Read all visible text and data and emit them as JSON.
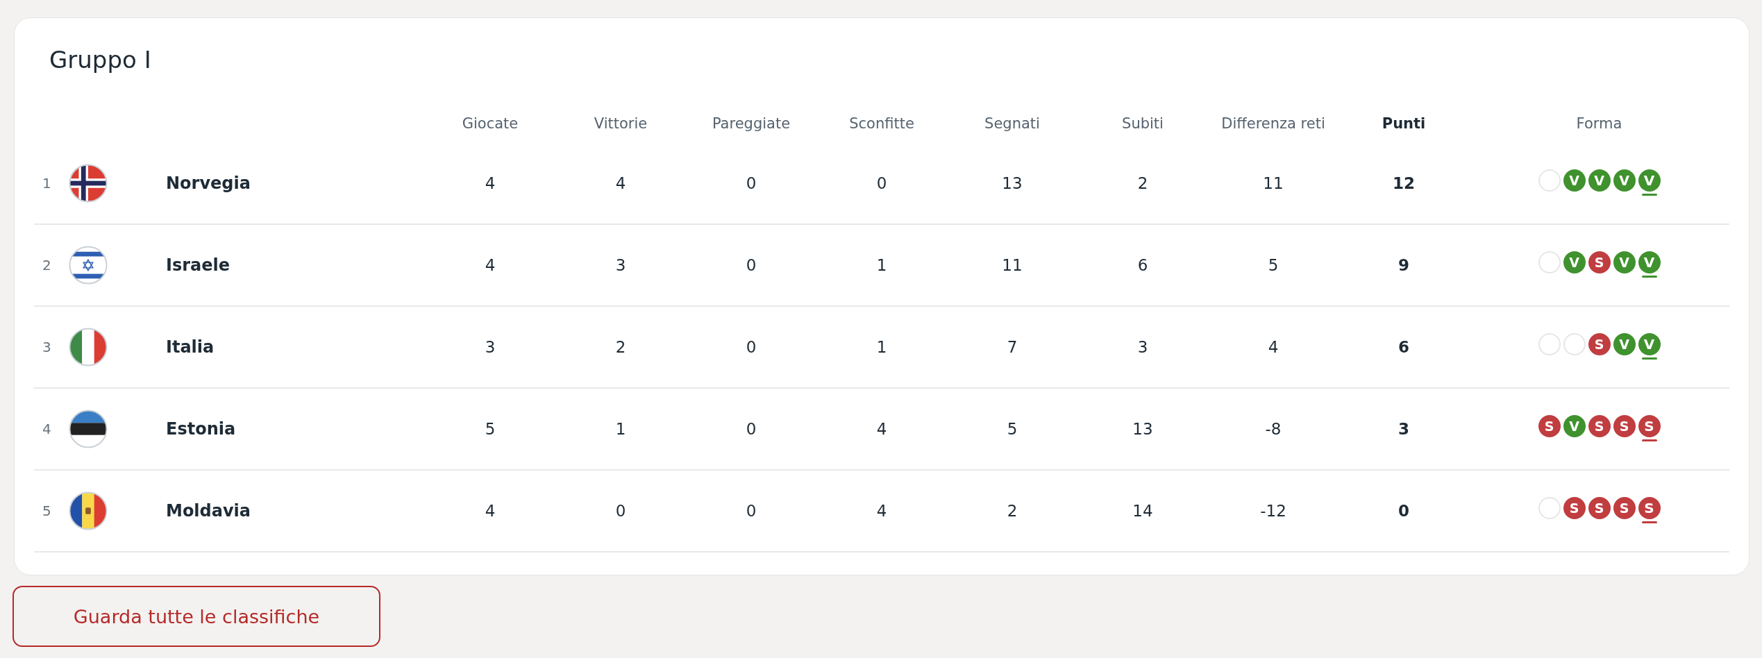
{
  "group": {
    "title": "Gruppo I"
  },
  "columns": [
    {
      "label": "Giocate",
      "bold": false
    },
    {
      "label": "Vittorie",
      "bold": false
    },
    {
      "label": "Pareggiate",
      "bold": false
    },
    {
      "label": "Sconfitte",
      "bold": false
    },
    {
      "label": "Segnati",
      "bold": false
    },
    {
      "label": "Subiti",
      "bold": false
    },
    {
      "label": "Differenza reti",
      "bold": false
    },
    {
      "label": "Punti",
      "bold": true
    },
    {
      "label": "Forma",
      "bold": false
    }
  ],
  "rows": [
    {
      "rank": "1",
      "kind": "norway",
      "team": "Norvegia",
      "stats": [
        "4",
        "4",
        "0",
        "0",
        "13",
        "2",
        "11",
        "12"
      ],
      "form": [
        {
          "kind": "none",
          "latest": false
        },
        {
          "kind": "win",
          "label": "V",
          "latest": false
        },
        {
          "kind": "win",
          "label": "V",
          "latest": false
        },
        {
          "kind": "win",
          "label": "V",
          "latest": false
        },
        {
          "kind": "win",
          "label": "V",
          "latest": true
        }
      ]
    },
    {
      "rank": "2",
      "kind": "israel",
      "team": "Israele",
      "stats": [
        "4",
        "3",
        "0",
        "1",
        "11",
        "6",
        "5",
        "9"
      ],
      "form": [
        {
          "kind": "none",
          "latest": false
        },
        {
          "kind": "win",
          "label": "V",
          "latest": false
        },
        {
          "kind": "loss",
          "label": "S",
          "latest": false
        },
        {
          "kind": "win",
          "label": "V",
          "latest": false
        },
        {
          "kind": "win",
          "label": "V",
          "latest": true
        }
      ]
    },
    {
      "rank": "3",
      "kind": "italy",
      "team": "Italia",
      "stats": [
        "3",
        "2",
        "0",
        "1",
        "7",
        "3",
        "4",
        "6"
      ],
      "form": [
        {
          "kind": "none",
          "latest": false
        },
        {
          "kind": "none",
          "latest": false
        },
        {
          "kind": "loss",
          "label": "S",
          "latest": false
        },
        {
          "kind": "win",
          "label": "V",
          "latest": false
        },
        {
          "kind": "win",
          "label": "V",
          "latest": true
        }
      ]
    },
    {
      "rank": "4",
      "kind": "estonia",
      "team": "Estonia",
      "stats": [
        "5",
        "1",
        "0",
        "4",
        "5",
        "13",
        "-8",
        "3"
      ],
      "form": [
        {
          "kind": "loss",
          "label": "S",
          "latest": false
        },
        {
          "kind": "win",
          "label": "V",
          "latest": false
        },
        {
          "kind": "loss",
          "label": "S",
          "latest": false
        },
        {
          "kind": "loss",
          "label": "S",
          "latest": false
        },
        {
          "kind": "loss",
          "label": "S",
          "latest": true
        }
      ]
    },
    {
      "rank": "5",
      "kind": "moldova",
      "team": "Moldavia",
      "stats": [
        "4",
        "0",
        "0",
        "4",
        "2",
        "14",
        "-12",
        "0"
      ],
      "form": [
        {
          "kind": "none",
          "latest": false
        },
        {
          "kind": "loss",
          "label": "S",
          "latest": false
        },
        {
          "kind": "loss",
          "label": "S",
          "latest": false
        },
        {
          "kind": "loss",
          "label": "S",
          "latest": false
        },
        {
          "kind": "loss",
          "label": "S",
          "latest": true
        }
      ]
    }
  ],
  "button": {
    "label": "Guarda tutte le classifiche"
  }
}
